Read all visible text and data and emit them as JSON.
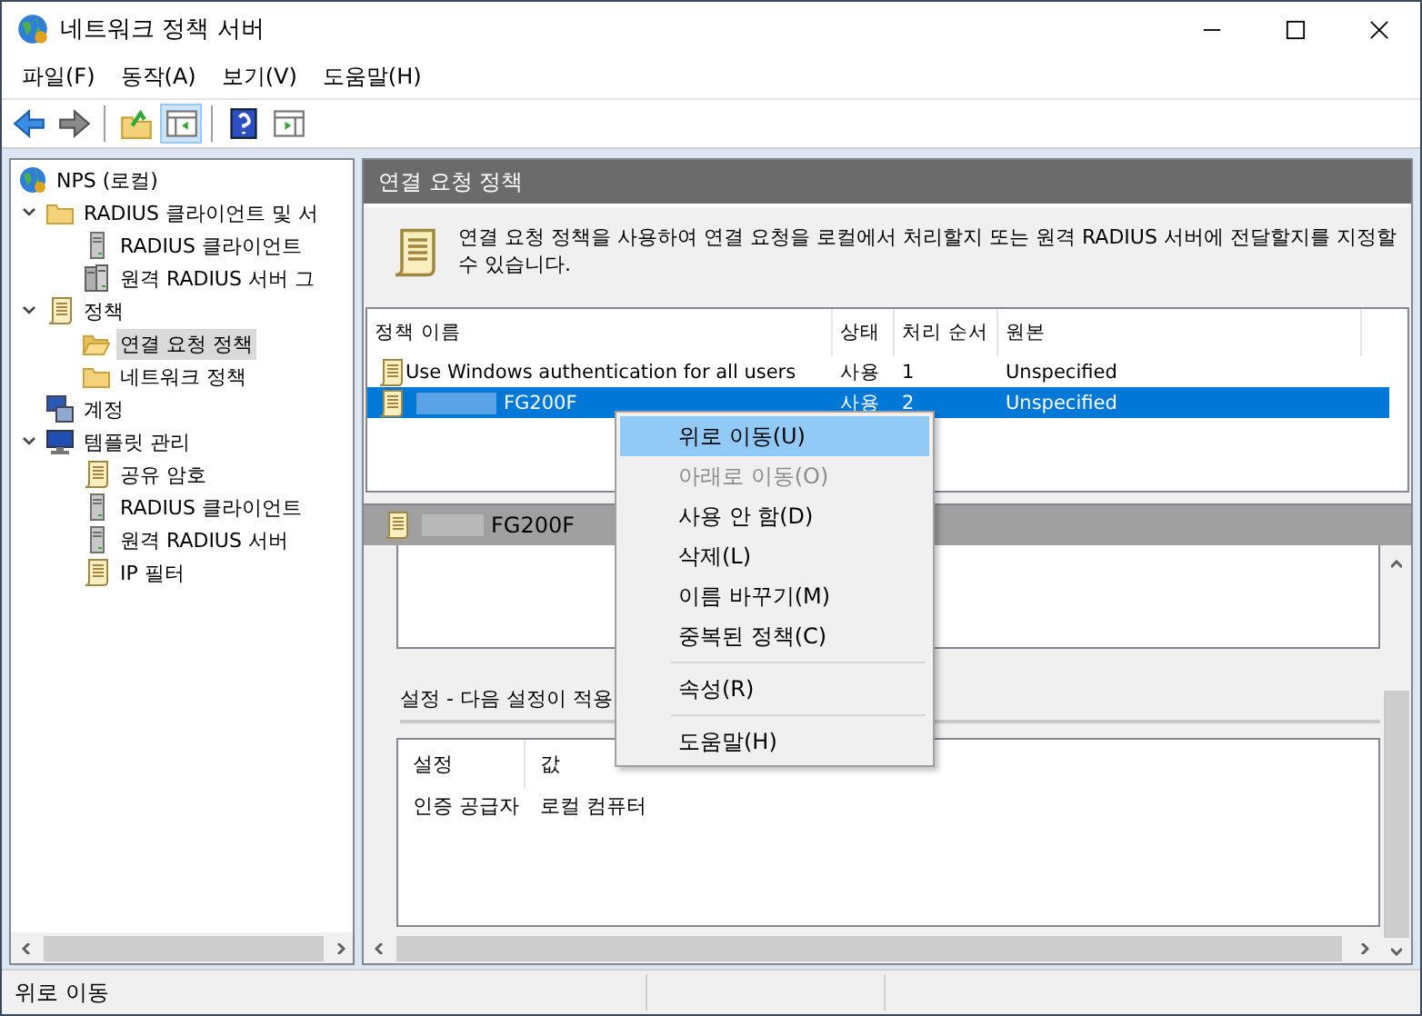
{
  "window": {
    "title": "네트워크 정책 서버"
  },
  "menu": [
    "파일(F)",
    "동작(A)",
    "보기(V)",
    "도움말(H)"
  ],
  "toolbar": [
    {
      "kind": "back",
      "on": false
    },
    {
      "kind": "forward",
      "on": false
    },
    {
      "kind": "separator"
    },
    {
      "kind": "up",
      "on": false
    },
    {
      "kind": "tree",
      "on": true
    },
    {
      "kind": "separator"
    },
    {
      "kind": "help",
      "on": false
    },
    {
      "kind": "action-pane",
      "on": false
    }
  ],
  "tree": [
    {
      "label": "NPS (로컬)",
      "kind": "globe",
      "selected": false,
      "children": [
        {
          "label": "RADIUS 클라이언트 및 서",
          "kind": "folder",
          "expanded": true,
          "selected": false,
          "children": [
            {
              "label": "RADIUS 클라이언트",
              "kind": "server",
              "selected": false
            },
            {
              "label": "원격 RADIUS 서버 그",
              "kind": "server-group",
              "selected": false
            }
          ]
        },
        {
          "label": "정책",
          "kind": "scroll",
          "expanded": true,
          "selected": false,
          "children": [
            {
              "label": "연결 요청 정책",
              "kind": "folder-open",
              "selected": true
            },
            {
              "label": "네트워크 정책",
              "kind": "folder",
              "selected": false
            }
          ]
        },
        {
          "label": "계정",
          "kind": "computers",
          "selected": false
        },
        {
          "label": "템플릿 관리",
          "kind": "monitor",
          "expanded": true,
          "selected": false,
          "children": [
            {
              "label": "공유 암호",
              "kind": "scroll",
              "selected": false
            },
            {
              "label": "RADIUS 클라이언트",
              "kind": "server",
              "selected": false
            },
            {
              "label": "원격 RADIUS 서버",
              "kind": "server",
              "selected": false
            },
            {
              "label": "IP 필터",
              "kind": "scroll",
              "selected": false
            }
          ]
        }
      ]
    }
  ],
  "detail": {
    "title": "연결 요청 정책",
    "description": "연결 요청 정책을 사용하여 연결 요청을 로컬에서 처리할지 또는 원격 RADIUS 서버에 전달할지를 지정할 수 있습니다.",
    "columns": [
      "정책 이름",
      "상태",
      "처리 순서",
      "원본"
    ],
    "rows": [
      {
        "name": "Use Windows authentication for all users",
        "redacted": false,
        "status": "사용",
        "order": "1",
        "source": "Unspecified",
        "selected": false
      },
      {
        "name": "FG200F",
        "redacted": true,
        "status": "사용",
        "order": "2",
        "source": "Unspecified",
        "selected": true
      }
    ]
  },
  "policy_pane": {
    "title": "FG200F",
    "redacted": true,
    "section_label": "설정 - 다음 설정이 적용",
    "columns": [
      "설정",
      "값"
    ],
    "rows": [
      [
        "인증 공급자",
        "로컬 컴퓨터"
      ]
    ]
  },
  "context_menu": [
    {
      "kind": "item",
      "label": "위로 이동(U)",
      "selected": true,
      "disabled": false
    },
    {
      "kind": "item",
      "label": "아래로 이동(O)",
      "selected": false,
      "disabled": true
    },
    {
      "kind": "item",
      "label": "사용 안 함(D)",
      "selected": false,
      "disabled": false
    },
    {
      "kind": "item",
      "label": "삭제(L)",
      "selected": false,
      "disabled": false
    },
    {
      "kind": "item",
      "label": "이름 바꾸기(M)",
      "selected": false,
      "disabled": false
    },
    {
      "kind": "item",
      "label": "중복된 정책(C)",
      "selected": false,
      "disabled": false
    },
    {
      "kind": "separator"
    },
    {
      "kind": "item",
      "label": "속성(R)",
      "selected": false,
      "disabled": false
    },
    {
      "kind": "separator"
    },
    {
      "kind": "item",
      "label": "도움말(H)",
      "selected": false,
      "disabled": false
    }
  ],
  "status_bar": {
    "text": "위로 이동"
  }
}
